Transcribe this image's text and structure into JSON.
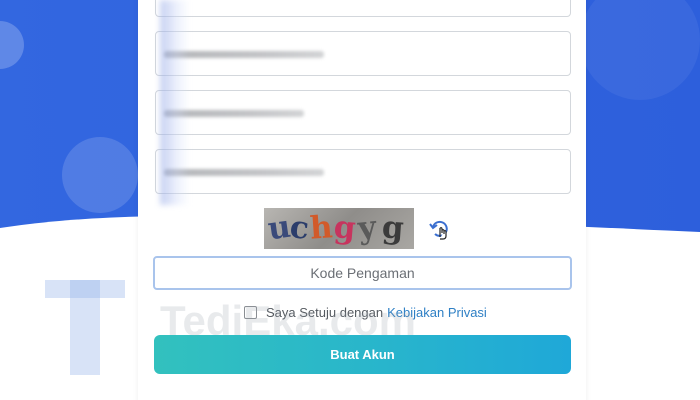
{
  "colors": {
    "background_blue": "#2f63df",
    "accent_button": "#28b5cc",
    "link": "#2f80c5",
    "input_focus_border": "#a9c4ec"
  },
  "captcha": {
    "image_text": "uchgyg",
    "refresh_icon": "refresh-icon"
  },
  "code_field": {
    "placeholder": "Kode Pengaman"
  },
  "agreement": {
    "text": "Saya Setuju dengan",
    "link_text": "Kebijakan Privasi"
  },
  "submit": {
    "label": "Buat Akun"
  },
  "watermark": {
    "text": "TediEka.com"
  }
}
